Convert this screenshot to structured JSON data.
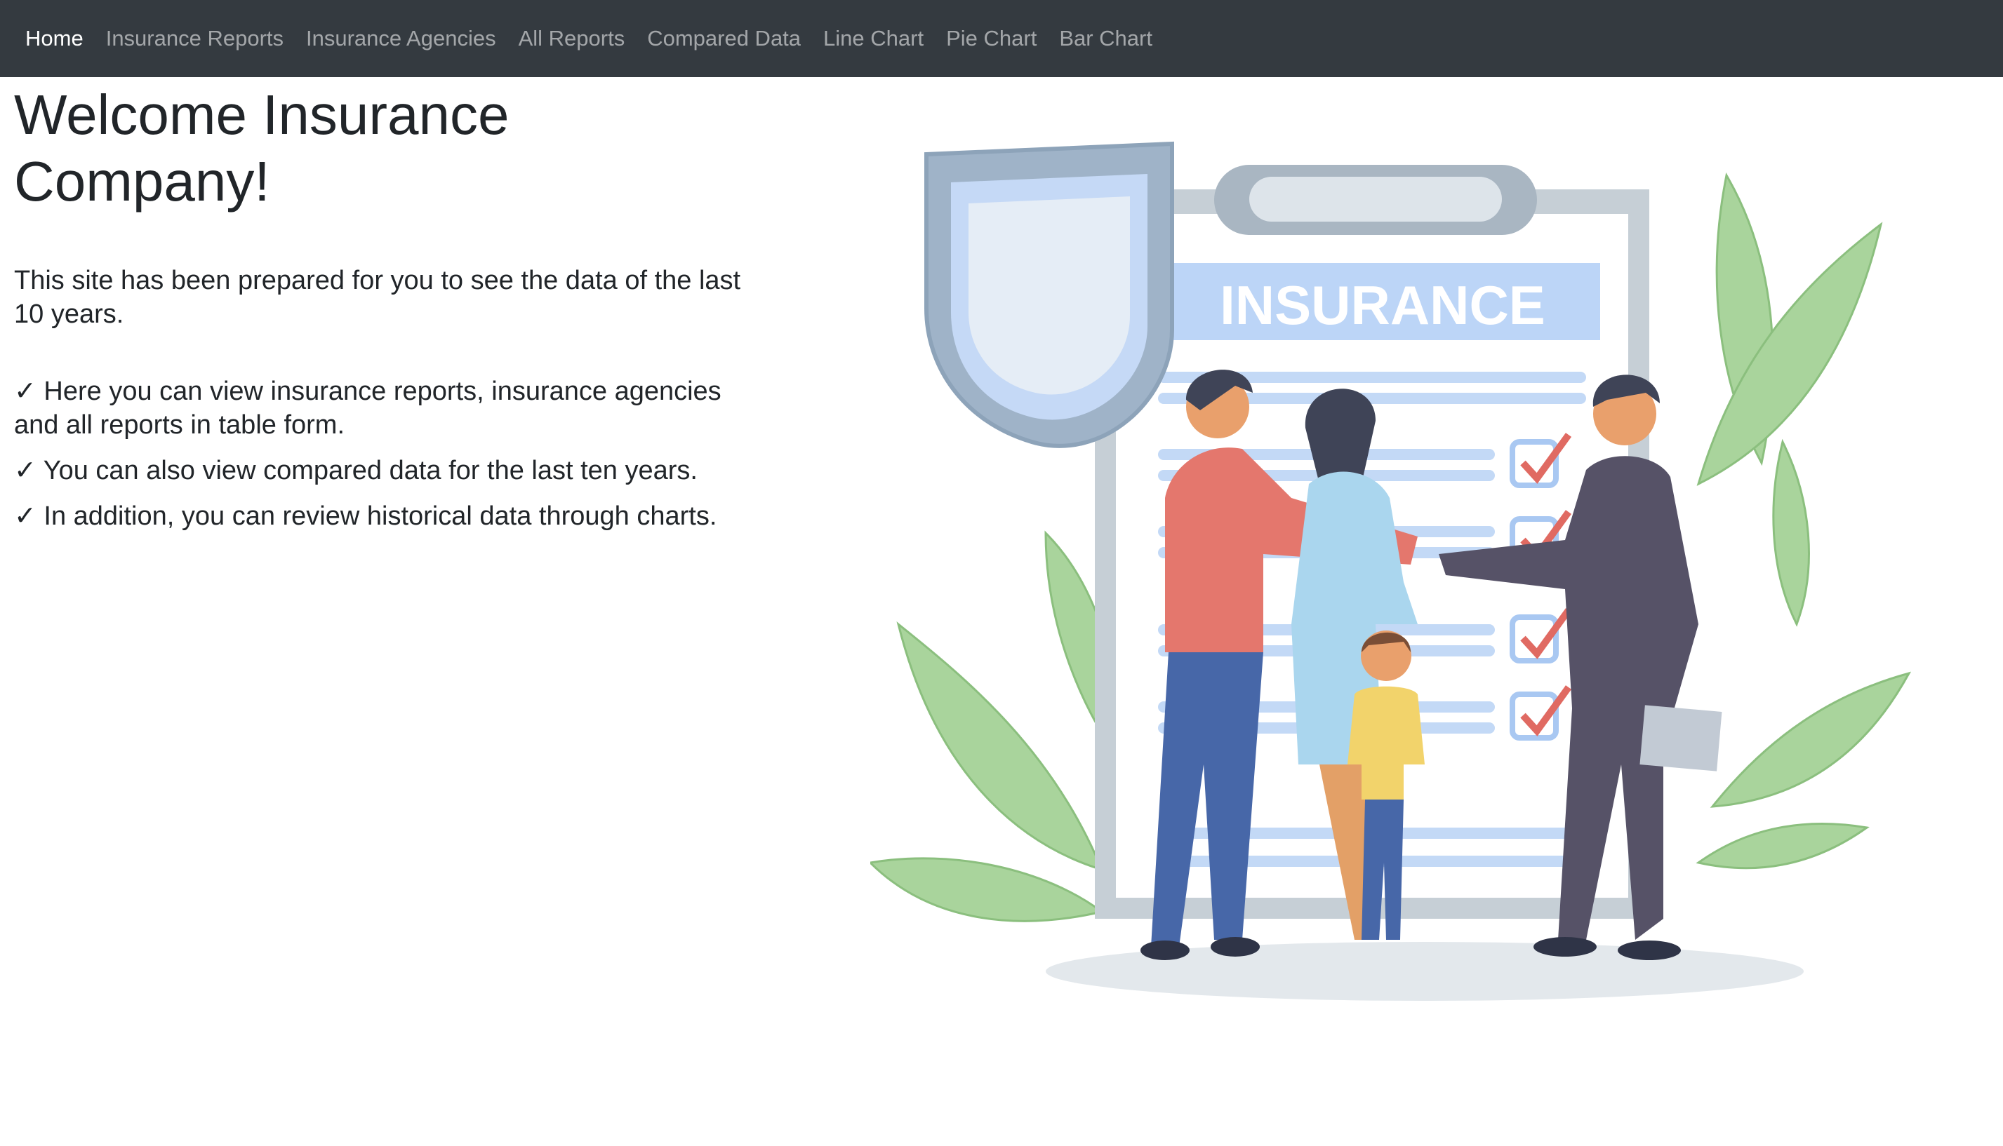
{
  "nav": {
    "items": [
      {
        "label": "Home",
        "active": true
      },
      {
        "label": "Insurance Reports",
        "active": false
      },
      {
        "label": "Insurance Agencies",
        "active": false
      },
      {
        "label": "All Reports",
        "active": false
      },
      {
        "label": "Compared Data",
        "active": false
      },
      {
        "label": "Line Chart",
        "active": false
      },
      {
        "label": "Pie Chart",
        "active": false
      },
      {
        "label": "Bar Chart",
        "active": false
      }
    ]
  },
  "main": {
    "title_line1": "Welcome Insurance",
    "title_line2": "Company!",
    "intro": "This site has been prepared for you to see the data of the last 10 years.",
    "features": [
      "✓ Here you can view insurance reports, insurance agencies and all reports in table form.",
      "✓ You can also view compared data for the last ten years.",
      "✓ In addition, you can review historical data through charts."
    ]
  },
  "illustration": {
    "clipboard_heading": "INSURANCE"
  },
  "colors": {
    "navbar_bg": "#343a40",
    "nav_inactive": "rgba(255,255,255,0.55)",
    "nav_active": "#ffffff",
    "text": "#212529"
  }
}
